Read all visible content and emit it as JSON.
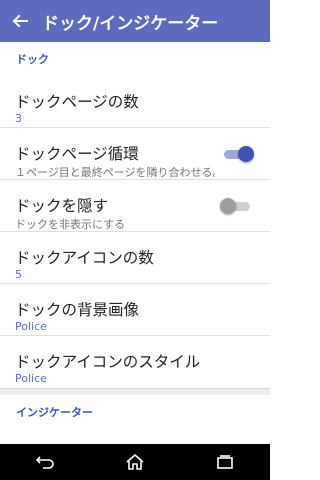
{
  "appbar": {
    "title": "ドック/インジケーター"
  },
  "sections": {
    "dock_header": "ドック",
    "indicator_header": "インジケーター"
  },
  "dock": {
    "page_count": {
      "title": "ドックページの数",
      "value": "3"
    },
    "page_loop": {
      "title": "ドックページ循環",
      "summary": "１ページ目と最終ページを隣り合わせる。",
      "enabled": true
    },
    "hide": {
      "title": "ドックを隠す",
      "summary": "ドックを非表示にする",
      "enabled": false
    },
    "icon_count": {
      "title": "ドックアイコンの数",
      "value": "5"
    },
    "background": {
      "title": "ドックの背景画像",
      "value": "Police"
    },
    "icon_style": {
      "title": "ドックアイコンのスタイル",
      "value": "Police"
    }
  },
  "colors": {
    "accent": "#5c6bc0",
    "accent_dark": "#3f51b5"
  },
  "icons": {
    "back": "arrow-back-icon",
    "nav": [
      "back-nav-icon",
      "home-icon",
      "recents-icon"
    ]
  }
}
